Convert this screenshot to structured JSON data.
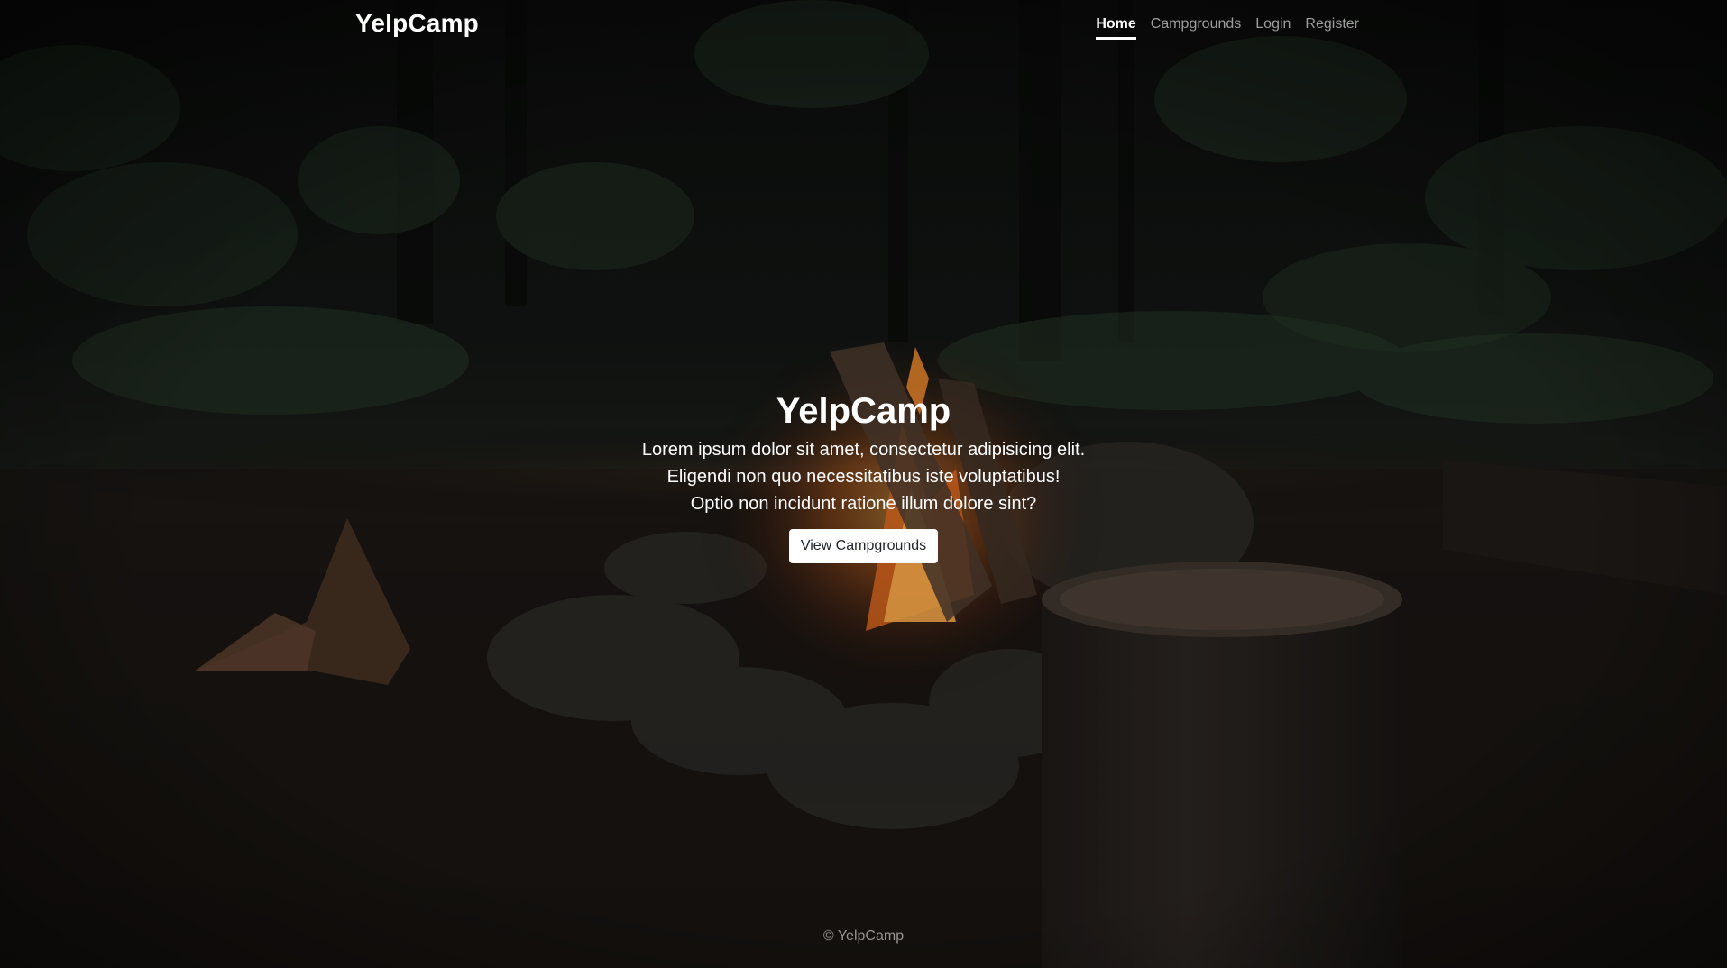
{
  "nav": {
    "brand": "YelpCamp",
    "links": [
      {
        "label": "Home",
        "active": true
      },
      {
        "label": "Campgrounds",
        "active": false
      },
      {
        "label": "Login",
        "active": false
      },
      {
        "label": "Register",
        "active": false
      }
    ]
  },
  "hero": {
    "title": "YelpCamp",
    "lines": [
      "Lorem ipsum dolor sit amet, consectetur adipisicing elit.",
      "Eligendi non quo necessitatibus iste voluptatibus!",
      "Optio non incidunt ratione illum dolore sint?"
    ],
    "button_label": "View Campgrounds"
  },
  "footer": {
    "text": "© YelpCamp"
  },
  "colors": {
    "text": "#ffffff",
    "muted_link": "rgba(255,255,255,0.6)",
    "button_bg": "#ffffff",
    "button_text": "#212529"
  }
}
